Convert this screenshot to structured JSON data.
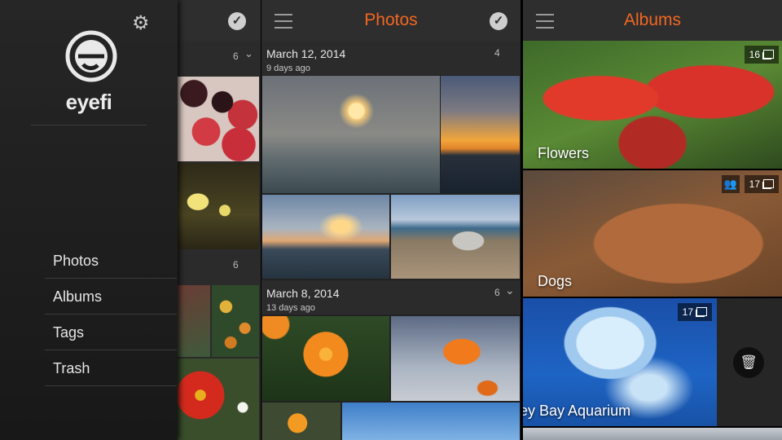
{
  "left_panel": {
    "brand": "eyefi",
    "menu": [
      "Photos",
      "Albums",
      "Tags",
      "Trash"
    ],
    "underlay_counts": [
      "6",
      "6"
    ]
  },
  "photos_panel": {
    "title": "Photos",
    "sections": [
      {
        "date": "March 12, 2014",
        "ago": "9 days ago",
        "count": "4"
      },
      {
        "date": "March 8, 2014",
        "ago": "13 days ago",
        "count": "6"
      }
    ]
  },
  "albums_panel": {
    "title": "Albums",
    "albums": [
      {
        "name": "Flowers",
        "count": "16"
      },
      {
        "name": "Dogs",
        "count": "17"
      },
      {
        "name": "ey Bay Aquarium",
        "count": "17"
      }
    ]
  },
  "colors": {
    "accent": "#f26722",
    "header_bg": "#2e2e2e",
    "background": "#000000"
  }
}
